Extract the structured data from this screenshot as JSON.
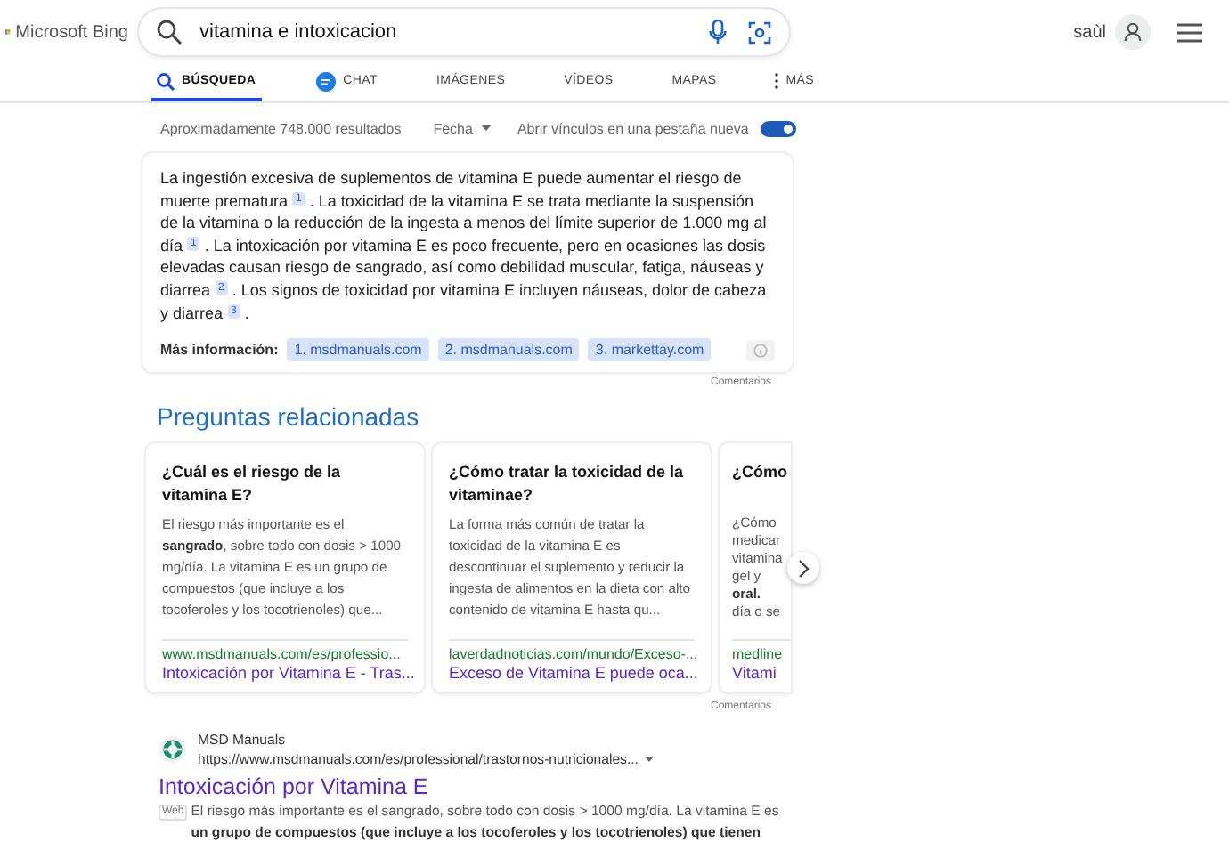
{
  "header": {
    "logo": "Microsoft Bing",
    "query": "vitamina e intoxicacion",
    "user": "saùl"
  },
  "tabs": [
    {
      "label": "BÚSQUEDA",
      "kind": "search",
      "selected": true
    },
    {
      "label": "CHAT",
      "kind": "chat",
      "selected": false
    },
    {
      "label": "IMÁGENES",
      "kind": "plain",
      "selected": false
    },
    {
      "label": "VÍDEOS",
      "kind": "plain",
      "selected": false
    },
    {
      "label": "MAPAS",
      "kind": "plain",
      "selected": false
    },
    {
      "label": "MÁS",
      "kind": "more",
      "selected": false
    }
  ],
  "toolbar": {
    "count": "Aproximadamente 748.000 resultados",
    "date_filter": "Fecha",
    "new_tab_label": "Abrir vínculos en una pestaña nueva",
    "new_tab_on": true
  },
  "answer": {
    "segments": [
      {
        "text": "La ingestión excesiva de suplementos de vitamina E puede aumentar el riesgo de muerte prematura",
        "cite": "1"
      },
      {
        "text": ". La toxicidad de la vitamina E se trata mediante la suspensión de la vitamina o la reducción de la ingesta a menos del límite superior de 1.000 mg al día",
        "cite": "1"
      },
      {
        "text": ". La intoxicación por vitamina E es poco frecuente, pero en ocasiones las dosis elevadas causan riesgo de sangrado, así como debilidad muscular, fatiga, náuseas y diarrea",
        "cite": "2"
      },
      {
        "text": ". Los signos de toxicidad por vitamina E incluyen náuseas, dolor de cabeza y diarrea",
        "cite": "3"
      },
      {
        "text": "."
      }
    ],
    "more_label": "Más información:",
    "sources": [
      "1. msdmanuals.com",
      "2. msdmanuals.com",
      "3. markettay.com"
    ],
    "feedback": "Comentarios"
  },
  "related": {
    "title": "Preguntas relacionadas",
    "cards": [
      {
        "kind": "full",
        "question": "¿Cuál es el riesgo de la vitamina E?",
        "body": "El riesgo más importante es el **sangrado**, sobre todo con dosis > 1000 mg/día. La vitamina E es un grupo de compuestos (que incluye a los tocoferoles y los tocotrienoles) que...",
        "url": "www.msdmanuals.com/es/professio...",
        "link": "Intoxicación por Vitamina E - Tras..."
      },
      {
        "kind": "full",
        "question": "¿Cómo tratar la toxicidad de la vitaminae?",
        "body": "La forma más común de tratar la toxicidad de la vitamina E es descontinuar el suplemento y reducir la ingesta de alimentos en la dieta con alto contenido de vitamina E hasta qu...",
        "url": "laverdadnoticias.com/mundo/Exceso-...",
        "link": "Exceso de Vitamina E puede oca..."
      },
      {
        "kind": "partial",
        "question": "¿Cómo",
        "body": "¿Cómo\nmedicar\nvitamina\ngel y\n**oral.**\ndía o se",
        "url": "medline",
        "link": "Vitami"
      }
    ],
    "feedback": "Comentarios"
  },
  "result": {
    "site": "MSD Manuals",
    "url": "https://www.msdmanuals.com/es/professional/trastornos-nutricionales...",
    "title": "Intoxicación por Vitamina E",
    "badge": "Web",
    "snippet": "El riesgo más importante es el sangrado, sobre todo con dosis > 1000 mg/día. La vitamina E es **un grupo de compuestos (que incluye a los tocoferoles y los tocotrienoles) que tienen**"
  }
}
